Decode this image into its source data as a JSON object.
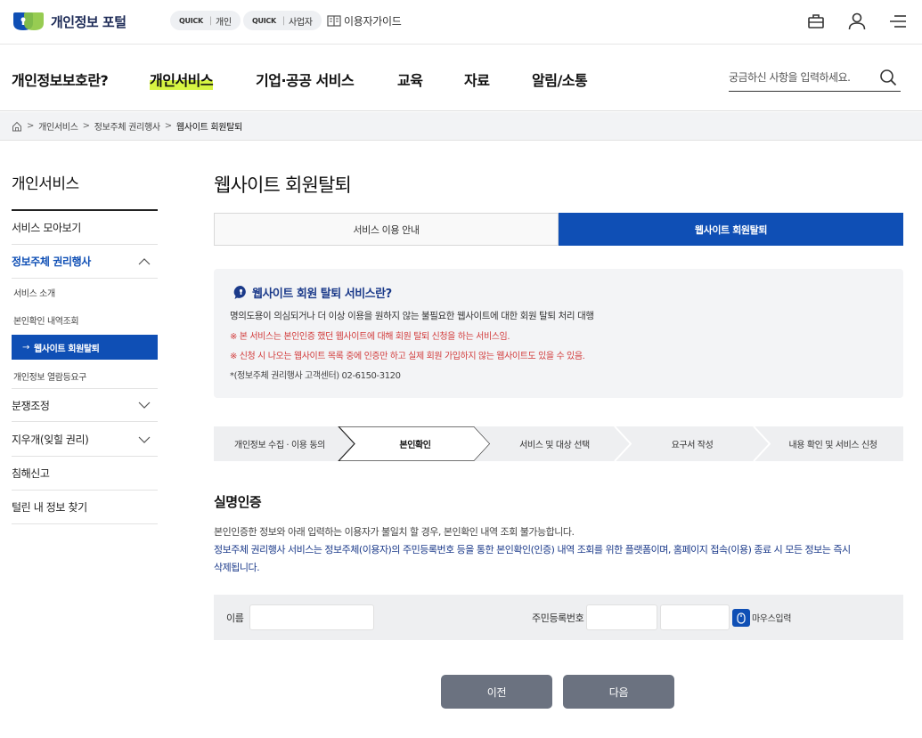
{
  "header": {
    "logo_text": "개인정보 포털",
    "quick_personal": {
      "prefix": "QUICK",
      "label": "개인"
    },
    "quick_business": {
      "prefix": "QUICK",
      "label": "사업자"
    },
    "guide_label": "이용자가이드"
  },
  "gnb": {
    "items": [
      "개인정보보호란?",
      "개인서비스",
      "기업·공공 서비스",
      "교육",
      "자료",
      "알림/소통"
    ],
    "active_index": 1,
    "search_placeholder": "궁금하신 사항을 입력하세요."
  },
  "breadcrumb": [
    "개인서비스",
    "정보주체 권리행사",
    "웹사이트 회원탈퇴"
  ],
  "sidebar": {
    "title": "개인서비스",
    "items": [
      {
        "label": "서비스 모아보기"
      },
      {
        "label": "정보주체 권리행사",
        "expanded": true
      },
      {
        "label": "분쟁조정"
      },
      {
        "label": "지우개(잊힐 권리)"
      },
      {
        "label": "침해신고"
      },
      {
        "label": "털린 내 정보 찾기"
      }
    ],
    "subitems": [
      "서비스 소개",
      "본인확인 내역조회",
      "웹사이트 회원탈퇴",
      "개인정보 열람등요구"
    ],
    "active_sub_index": 2,
    "active_arrow": "→"
  },
  "main": {
    "title": "웹사이트 회원탈퇴",
    "tabs": [
      "서비스 이용 안내",
      "웹사이트 회원탈퇴"
    ],
    "active_tab": 1,
    "info": {
      "title": "웹사이트 회원 탈퇴 서비스란?",
      "desc": "명의도용이 의심되거나 더 이상 이용을 원하지 않는 불필요한 웹사이트에 대한 회원 탈퇴 처리 대행",
      "note1": "※ 본 서비스는 본인인증 했던 웹사이트에 대해 회원 탈퇴 신청을 하는 서비스임.",
      "note2": "※ 신청 시 나오는 웹사이트 목록 중에 인증만 하고 실제 회원 가입하지 않는 웹사이트도 있을 수 있음.",
      "contact": "*(정보주체 권리행사 고객센터) 02-6150-3120"
    },
    "steps": [
      "개인정보 수집 · 이용 동의",
      "본인확인",
      "서비스 및 대상 선택",
      "요구서 작성",
      "내용 확인 및 서비스 신청"
    ],
    "active_step": 1,
    "verify": {
      "title": "실명인증",
      "line1": "본인인증한 정보와 아래 입력하는 이용자가 불일치 할 경우, 본인확인 내역 조회 불가능합니다.",
      "line2": "정보주체 권리행사 서비스는 정보주체(이용자)의 주민등록번호 등을 통한 본인확인(인증) 내역 조회를 위한 플랫폼이며, 홈페이지 접속(이용) 종료 시 모든 정보는 즉시",
      "line3": "삭제됩니다.",
      "name_label": "이름",
      "name_value": "",
      "rrn_label": "주민등록번호",
      "rrn_front": "",
      "rrn_back": "",
      "mouse_input_label": "마우스입력"
    },
    "buttons": {
      "prev": "이전",
      "next": "다음"
    }
  }
}
